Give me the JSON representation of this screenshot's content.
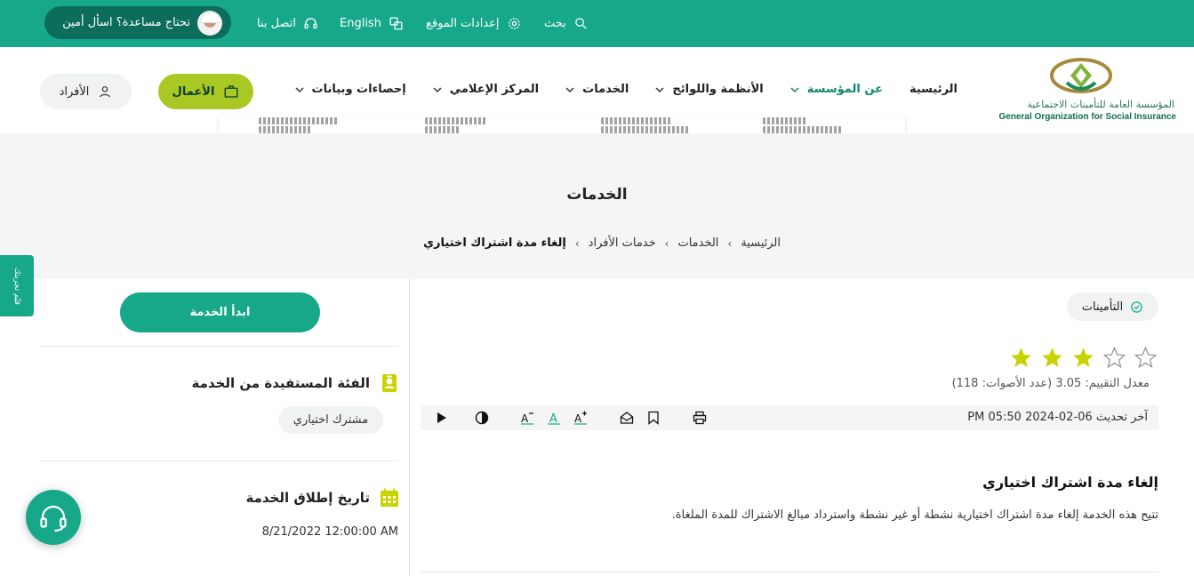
{
  "topbar": {
    "ask_label": "تحتاج مساعدة؟ اسأل أمين",
    "contact_label": "اتصل بنا",
    "language_label": "English",
    "settings_label": "إعدادات الموقع",
    "search_label": "بحث"
  },
  "logo": {
    "arabic_name": "المؤسسة العامة للتأمينات الاجتماعية",
    "english_name": "General Organization for Social Insurance"
  },
  "nav": {
    "items": [
      {
        "label": "الرئيسية",
        "has_dropdown": false
      },
      {
        "label": "عن المؤسسة",
        "has_dropdown": true,
        "active": true
      },
      {
        "label": "الأنظمة واللوائح",
        "has_dropdown": true
      },
      {
        "label": "الخدمات",
        "has_dropdown": true
      },
      {
        "label": "المركز الإعلامي",
        "has_dropdown": true
      },
      {
        "label": "إحصاءات وبيانات",
        "has_dropdown": true
      }
    ],
    "business_label": "الأعمال",
    "individuals_label": "الأفراد"
  },
  "hero": {
    "title": "الخدمات",
    "breadcrumb": [
      "الرئيسية",
      "الخدمات",
      "خدمات الأفراد",
      "إلغاء مدة اشتراك اختياري"
    ]
  },
  "side_tab": {
    "label": "قيّم تجربتك"
  },
  "service": {
    "category_badge": "التأمينات",
    "rating_stars": 3,
    "rating_max": 5,
    "rating_text": "معدل التقييم: 3.05 (عدد الأصوات: 118)",
    "last_updated": "آخر تحديث 06-02-2024 05:50 PM",
    "title": "إلغاء مدة اشتراك اختياري",
    "description": "تتيح هذه الخدمة إلغاء مدة اشتراك اختيارية نشطة أو غير نشطة واسترداد مبالغ الاشتراك للمدة الملغاة."
  },
  "sidebar": {
    "start_button": "ابدأ الخدمة",
    "beneficiary_title": "الفئة المستفيدة من الخدمة",
    "beneficiary_tag": "مشترك اختياري",
    "launch_title": "تاريخ إطلاق الخدمة",
    "launch_date": "8/21/2022 12:00:00 AM"
  },
  "colors": {
    "primary_green": "#17a88a",
    "dark_green": "#0c6d5b",
    "lime": "#a9c824",
    "star_yellow": "#c8d400"
  }
}
